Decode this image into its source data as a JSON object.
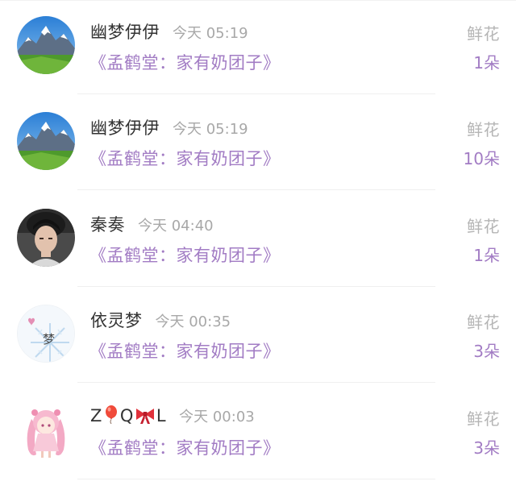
{
  "rows": [
    {
      "name": "幽梦伊伊",
      "time": "今天 05:19",
      "book": "《孟鹤堂：家有奶团子》",
      "gift": "鲜花",
      "count": "1朵",
      "avatar": "mountain-landscape-avatar"
    },
    {
      "name": "幽梦伊伊",
      "time": "今天 05:19",
      "book": "《孟鹤堂：家有奶团子》",
      "gift": "鲜花",
      "count": "10朵",
      "avatar": "mountain-landscape-avatar"
    },
    {
      "name": "秦奏",
      "time": "今天 04:40",
      "book": "《孟鹤堂：家有奶团子》",
      "gift": "鲜花",
      "count": "1朵",
      "avatar": "portrait-photo-avatar"
    },
    {
      "name": "依灵梦",
      "time": "今天 00:35",
      "book": "《孟鹤堂：家有奶团子》",
      "gift": "鲜花",
      "count": "3朵",
      "avatar": "snowflake-dream-avatar"
    },
    {
      "name_parts": [
        "Z",
        "Q",
        "L"
      ],
      "name_icons": [
        "balloon-icon",
        "bow-icon"
      ],
      "time": "今天 00:03",
      "book": "《孟鹤堂：家有奶团子》",
      "gift": "鲜花",
      "count": "3朵",
      "avatar": "anime-girl-avatar"
    }
  ],
  "colors": {
    "name": "#333333",
    "time": "#a8a8a8",
    "accent_purple": "#a27cc4",
    "gift_label": "#b5b5b5",
    "divider": "#efefef"
  }
}
